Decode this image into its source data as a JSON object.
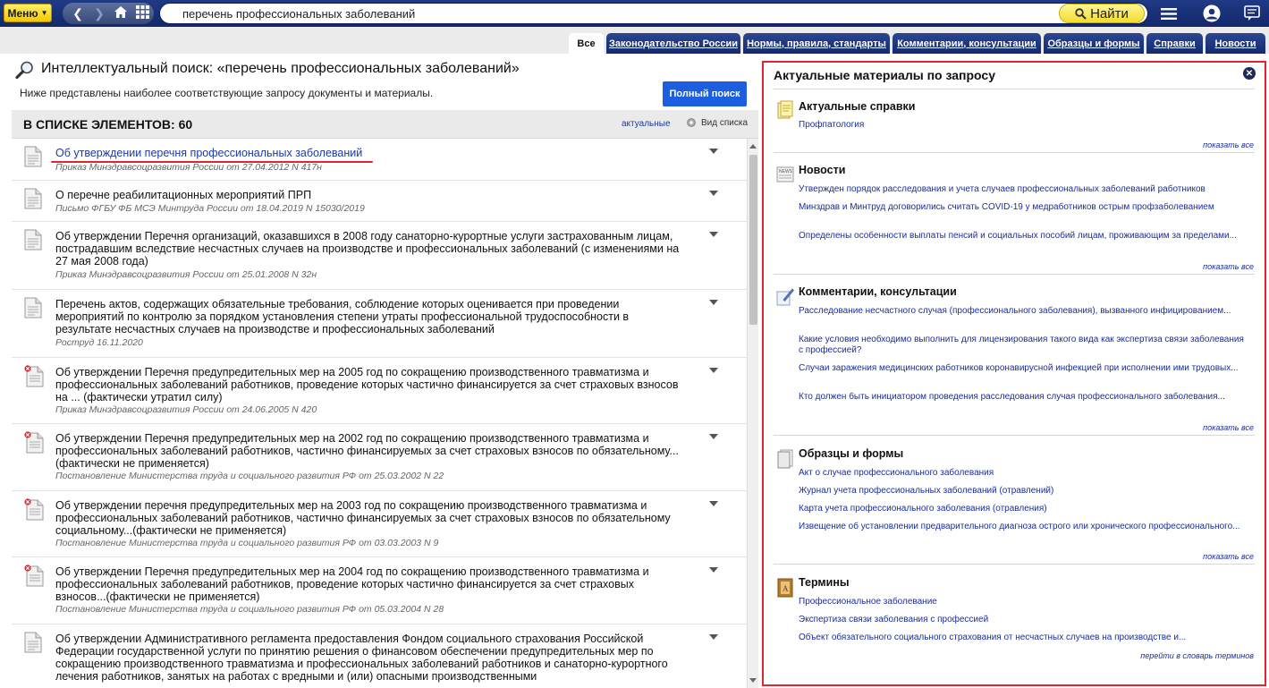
{
  "topbar": {
    "menu_label": "Меню",
    "search_value": "перечень профессиональных заболеваний",
    "find_label": "Найти"
  },
  "tabs": [
    {
      "label": "Все",
      "active": true
    },
    {
      "label": "Законодательство России"
    },
    {
      "label": "Нормы, правила, стандарты"
    },
    {
      "label": "Комментарии, консультации"
    },
    {
      "label": "Образцы и формы"
    },
    {
      "label": "Справки"
    },
    {
      "label": "Новости"
    }
  ],
  "search": {
    "title": "Интеллектуальный поиск: «перечень профессиональных заболеваний»",
    "subtitle": "Ниже представлены наиболее соответствующие запросу документы и материалы.",
    "full_search_label": "Полный поиск"
  },
  "list": {
    "count_label": "В СПИСКЕ ЭЛЕМЕНТОВ: 60",
    "actual_link": "актуальные",
    "view_label": "Вид списка",
    "items": [
      {
        "title": "Об утверждении перечня профессиональных заболеваний",
        "meta": "Приказ Минздравсоцразвития России от 27.04.2012 N 417н",
        "invalid": false,
        "link": true
      },
      {
        "title": "О перечне реабилитационных мероприятий ПРП",
        "meta": "Письмо ФГБУ ФБ МСЭ Минтруда России от 18.04.2019 N 15030/2019",
        "invalid": false
      },
      {
        "title": "Об утверждении Перечня организаций, оказавшихся в 2008 году санаторно-курортные услуги застрахованным лицам, пострадавшим вследствие несчастных случаев на производстве и профессиональных заболеваний (с изменениями на 27 мая 2008 года)",
        "meta": "Приказ Минздравсоцразвития России от 25.01.2008 N 32н",
        "invalid": false
      },
      {
        "title": "Перечень актов, содержащих обязательные требования, соблюдение которых оценивается при проведении мероприятий по контролю за порядком установления степени утраты профессиональной трудоспособности в результате несчастных случаев на производстве и профессиональных заболеваний",
        "meta": "Роструд 16.11.2020",
        "invalid": false
      },
      {
        "title": "Об утверждении Перечня предупредительных мер на 2005 год по сокращению производственного травматизма и профессиональных заболеваний работников, проведение которых частично финансируется за счет страховых взносов на ... (фактически утратил силу)",
        "meta": "Приказ Минздравсоцразвития России от 24.06.2005 N 420",
        "invalid": true
      },
      {
        "title": "Об утверждении Перечня предупредительных мер на 2002 год по сокращению производственного травматизма и профессиональных заболеваний работников, частично финансируемых за счет страховых взносов по обязательному...(фактически не применяется)",
        "meta": "Постановление Министерства труда и социального развития РФ от 25.03.2002 N 22",
        "invalid": true
      },
      {
        "title": "Об утверждении перечня предупредительных мер на 2003 год по сокращению производственного травматизма и профессиональных заболеваний работников, частично финансируемых за счет страховых взносов по обязательному социальному...(фактически не применяется)",
        "meta": "Постановление Министерства труда и социального развития РФ от 03.03.2003 N 9",
        "invalid": true
      },
      {
        "title": "Об утверждении Перечня предупредительных мер на 2004 год по сокращению производственного травматизма и профессиональных заболеваний работников, проведение которых частично финансируется за счет страховых взносов...(фактически не применяется)",
        "meta": "Постановление Министерства труда и социального развития РФ от 05.03.2004 N 28",
        "invalid": true
      },
      {
        "title": "Об утверждении Административного регламента предоставления Фондом социального страхования Российской Федерации государственной услуги по принятию решения о финансовом обеспечении предупредительных мер по сокращению производственного травматизма и профессиональных заболеваний работников и санаторно-курортного лечения работников, занятых на работах с вредными и (или) опасными производственными",
        "meta": "",
        "invalid": false
      }
    ]
  },
  "right_panel": {
    "title": "Актуальные материалы по запросу",
    "show_all": "показать все",
    "sections": [
      {
        "name": "Актуальные справки",
        "icon": "reference-icon",
        "links": [
          "Профпатология"
        ]
      },
      {
        "name": "Новости",
        "icon": "news-icon",
        "links": [
          "Утвержден порядок расследования и учета случаев профессиональных заболеваний работников",
          "Минздрав и Минтруд договорились считать COVID-19 у медработников острым профзаболеванием",
          "Определены особенности выплаты пенсий и социальных пособий лицам, проживающим за пределами..."
        ]
      },
      {
        "name": "Комментарии, консультации",
        "icon": "comment-pen-icon",
        "links": [
          "Расследование несчастного случая (профессионального заболевания), вызванного инфицированием...",
          "Какие условия необходимо выполнить для лицензирования такого вида как экспертиза связи заболевания с профессией?",
          "Случаи заражения медицинских работников коронавирусной инфекцией при исполнении ими трудовых...",
          "Кто должен быть инициатором проведения расследования случая профессионального заболевания..."
        ]
      },
      {
        "name": "Образцы и формы",
        "icon": "forms-icon",
        "links": [
          "Акт о случае профессионального заболевания",
          "Журнал учета профессиональных заболеваний (отравлений)",
          "Карта учета профессионального заболевания (отравления)",
          "Извещение об установлении предварительного диагноза острого или хронического профессионального..."
        ]
      },
      {
        "name": "Термины",
        "icon": "dictionary-icon",
        "links": [
          "Профессиональное заболевание",
          "Экспертиза связи заболевания с профессией",
          "Объект обязательного социального страхования от несчастных случаев на производстве и..."
        ]
      }
    ],
    "dictionary_link": "перейти в словарь терминов"
  }
}
